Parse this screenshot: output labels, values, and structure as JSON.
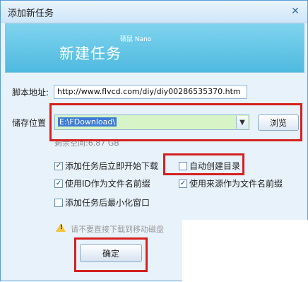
{
  "window": {
    "title": "添加新任务",
    "close_icon": "close-icon"
  },
  "banner": {
    "title": "新建任务",
    "subtitle": "硕鼠 Nano"
  },
  "form": {
    "script_label": "脚本地址:",
    "script_value": "http://www.flvcd.com/diy/diy00286535370.htm",
    "save_label": "储存位置",
    "save_value": "E:\\FDownload\\",
    "browse_label": "浏览",
    "free_space": "剩余空间:6.87 GB"
  },
  "options": {
    "start_now": {
      "label": "添加任务后立即开始下载",
      "checked": true
    },
    "auto_dir": {
      "label": "自动创建目录",
      "checked": false
    },
    "id_prefix": {
      "label": "使用ID作为文件名前缀",
      "checked": true
    },
    "source_prefix": {
      "label": "使用来源作为文件名前缀",
      "checked": true
    },
    "minimize": {
      "label": "添加任务后最小化窗口",
      "checked": false
    }
  },
  "warning": {
    "text": "请不要直接下载到移动磁盘",
    "icon": "warning-icon"
  },
  "buttons": {
    "ok_label": "确定"
  },
  "colors": {
    "banner": "#4fb9e0",
    "highlight": "#d42020",
    "selected_path_bg": "#d6f4c6"
  }
}
